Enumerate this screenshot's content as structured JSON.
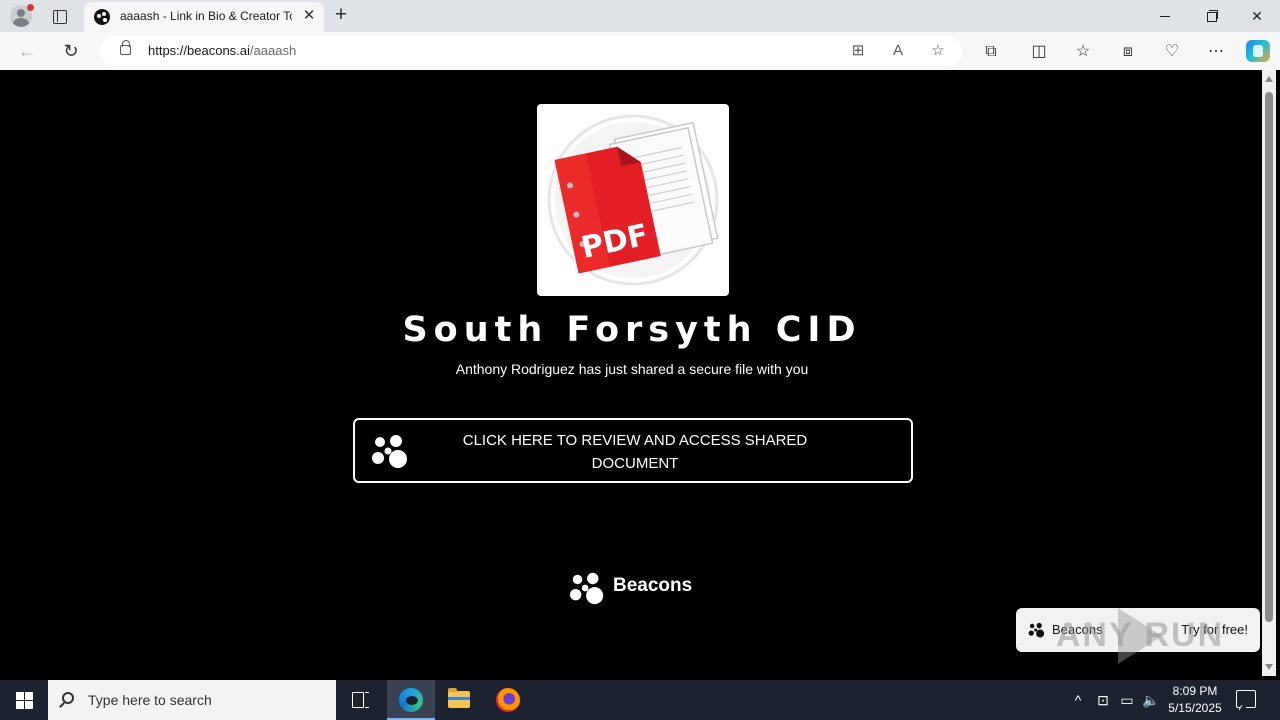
{
  "browser": {
    "tab_title": "aaaash - Link in Bio & Creator Tools",
    "new_tab_symbol": "+",
    "close_tab_symbol": "✕",
    "url_base": "https://beacons.ai",
    "url_path": "/aaaash",
    "window_controls": {
      "close_symbol": "✕"
    }
  },
  "page": {
    "background": "#000000",
    "title": "South Forsyth CID",
    "subtitle": "Anthony Rodriguez has just shared a secure file with you",
    "avatar_alt": "PDF document icon",
    "avatar_text": "PDF",
    "cta_label": "CLICK HERE TO REVIEW AND ACCESS SHARED DOCUMENT",
    "footer_brand": "Beacons",
    "promo": {
      "brand": "Beacons",
      "action": "Try for free!"
    },
    "watermark": "ANY RUN"
  },
  "taskbar": {
    "search_placeholder": "Type here to search",
    "time": "8:09 PM",
    "date": "5/15/2025"
  },
  "colors": {
    "accent": "#e31e24",
    "tab_bg": "#dfe3e8",
    "taskbar": "#1c2230"
  }
}
